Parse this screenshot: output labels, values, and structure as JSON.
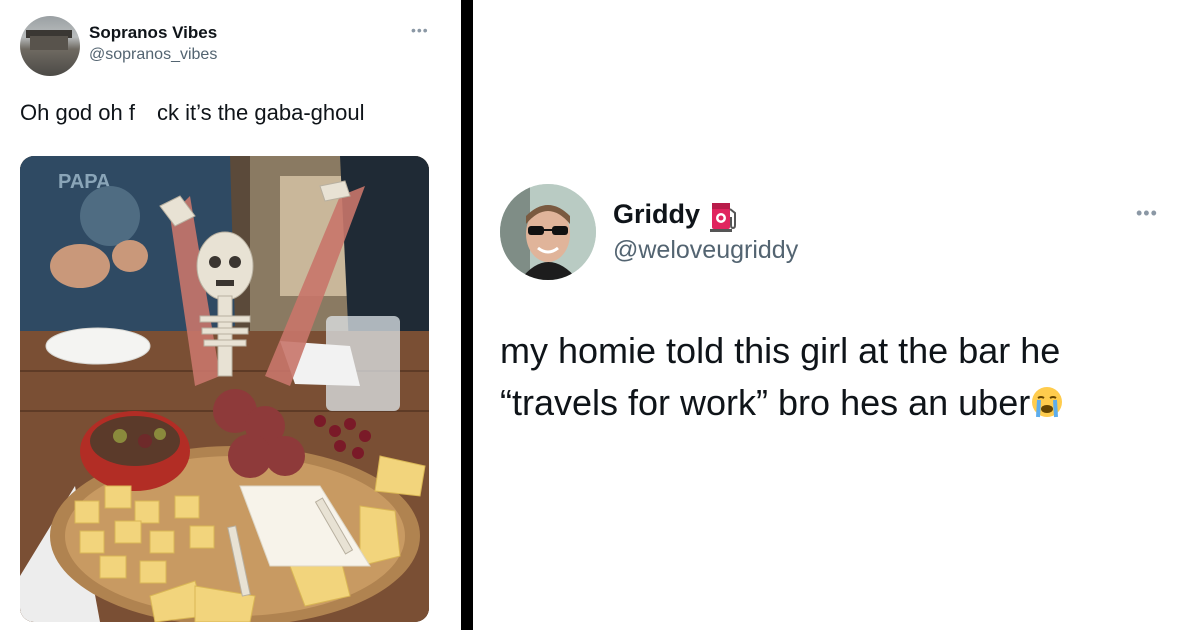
{
  "left_tweet": {
    "display_name": "Sopranos Vibes",
    "handle": "@sopranos_vibes",
    "more_icon": "ellipsis-icon",
    "text": "Oh god oh f ck it’s the gaba-ghoul",
    "photo_shirt_text": "PAPA"
  },
  "right_tweet": {
    "display_name": "Griddy",
    "badge_icon": "fuel-pump-icon",
    "handle": "@weloveugriddy",
    "more_icon": "ellipsis-icon",
    "text_line1": "my homie told this girl at the bar he",
    "text_line2": "“travels for work” bro hes an uber",
    "emoji": "loudly-crying-face-icon"
  },
  "colors": {
    "name": "#0f1419",
    "handle": "#536471",
    "divider": "#000000",
    "badge_red": "#e0245e"
  }
}
